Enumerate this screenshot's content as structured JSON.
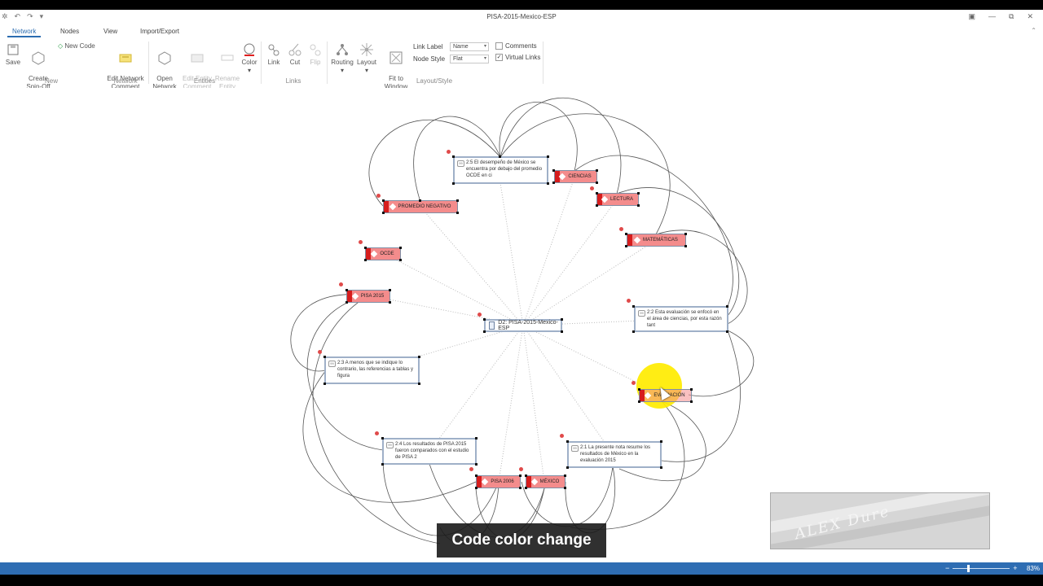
{
  "app": {
    "title": "PISA-2015-Mexico-ESP",
    "qat": [
      "↶",
      "↷",
      "▾"
    ],
    "window_controls": [
      "▣",
      "—",
      "⧉",
      "✕"
    ]
  },
  "tabs": [
    {
      "label": "Network",
      "active": true
    },
    {
      "label": "Nodes",
      "active": false
    },
    {
      "label": "View",
      "active": false
    },
    {
      "label": "Import/Export",
      "active": false
    }
  ],
  "ribbon": {
    "save": "Save",
    "create_spin_off": "Create\nSpin-Off",
    "new_code": "New Code",
    "edit_network_comment": "Edit Network\nComment",
    "open_network": "Open\nNetwork",
    "edit_entity_comment": "Edit Entity\nComment",
    "rename_entity": "Rename\nEntity",
    "color": "Color",
    "link": "Link",
    "cut": "Cut",
    "flip": "Flip",
    "routing": "Routing",
    "layout": "Layout",
    "fit_to_window": "Fit to\nWindow",
    "link_label": "Link Label",
    "link_label_value": "Name",
    "node_style": "Node Style",
    "node_style_value": "Flat",
    "comments": "Comments",
    "comments_checked": false,
    "virtual_links": "Virtual Links",
    "virtual_links_checked": true,
    "groups": {
      "new": "New",
      "network": "Network",
      "entities": "Entities",
      "links": "Links",
      "layout_style": "Layout/Style"
    }
  },
  "canvas": {
    "document_node": "D2: PISA-2015-Mexico-ESP",
    "codes": {
      "ciencias": "CIENCIAS",
      "lectura": "LECTURA",
      "promedio_negativo": "PROMEDIO NEGATIVO",
      "matematicas": "MATEMÁTICAS",
      "ocde": "OCDE",
      "pisa_2015": "PISA 2015",
      "evaluacion": "EVALUACIÓN",
      "pisa_2006": "PISA 2006",
      "mexico": "MÉXICO"
    },
    "quotations": {
      "q25": "2:5 El desempeño de México se encuentra por debajo del promedio OCDE en ci",
      "q22": "2:2 Esta evaluación se  enfocó en el área de ciencias, por esta razón tant",
      "q23": "2:3 A menos que se indique lo contrario, las referencias a tablas y figura",
      "q24": "2:4 Los resultados de PISA 2015 fueron comparados con el estudio de PISA 2",
      "q21": "2:1 La presente nota resume los resultados de México en la evaluación 2015"
    },
    "caption": "Code color change",
    "overlay_signature": "ALEX Dure"
  },
  "status": {
    "zoom_minus": "−",
    "zoom_plus": "+",
    "zoom": "83%"
  },
  "colors": {
    "accent": "#2b6cb0",
    "code_fill": "#f48c8c",
    "code_marker": "#d61d1d",
    "statusbar": "#2e6db3",
    "highlight": "#ffeb00"
  }
}
